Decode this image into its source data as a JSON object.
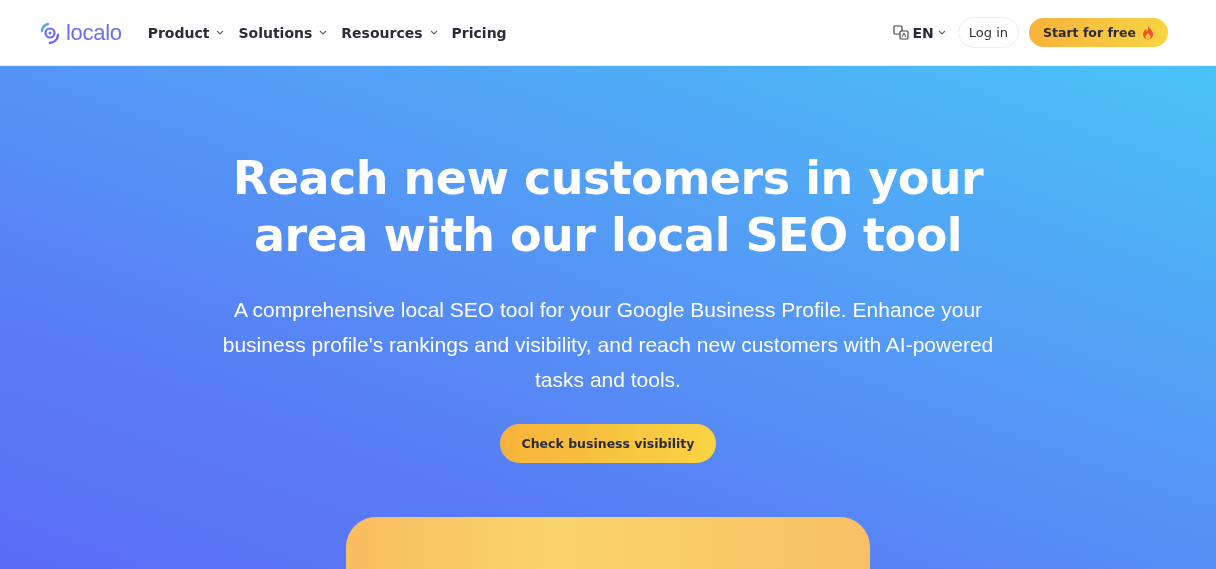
{
  "header": {
    "logo": "localo",
    "nav": [
      {
        "label": "Product",
        "dropdown": true
      },
      {
        "label": "Solutions",
        "dropdown": true
      },
      {
        "label": "Resources",
        "dropdown": true
      },
      {
        "label": "Pricing",
        "dropdown": false
      }
    ],
    "language": "EN",
    "login": "Log in",
    "cta": "Start for free"
  },
  "hero": {
    "title": "Reach new customers in your area with our local SEO tool",
    "subtitle": "A comprehensive local SEO tool for your Google Business Profile. Enhance your business profile's rankings and visibility, and reach new customers with AI-powered tasks and tools.",
    "button": "Check business visibility"
  }
}
